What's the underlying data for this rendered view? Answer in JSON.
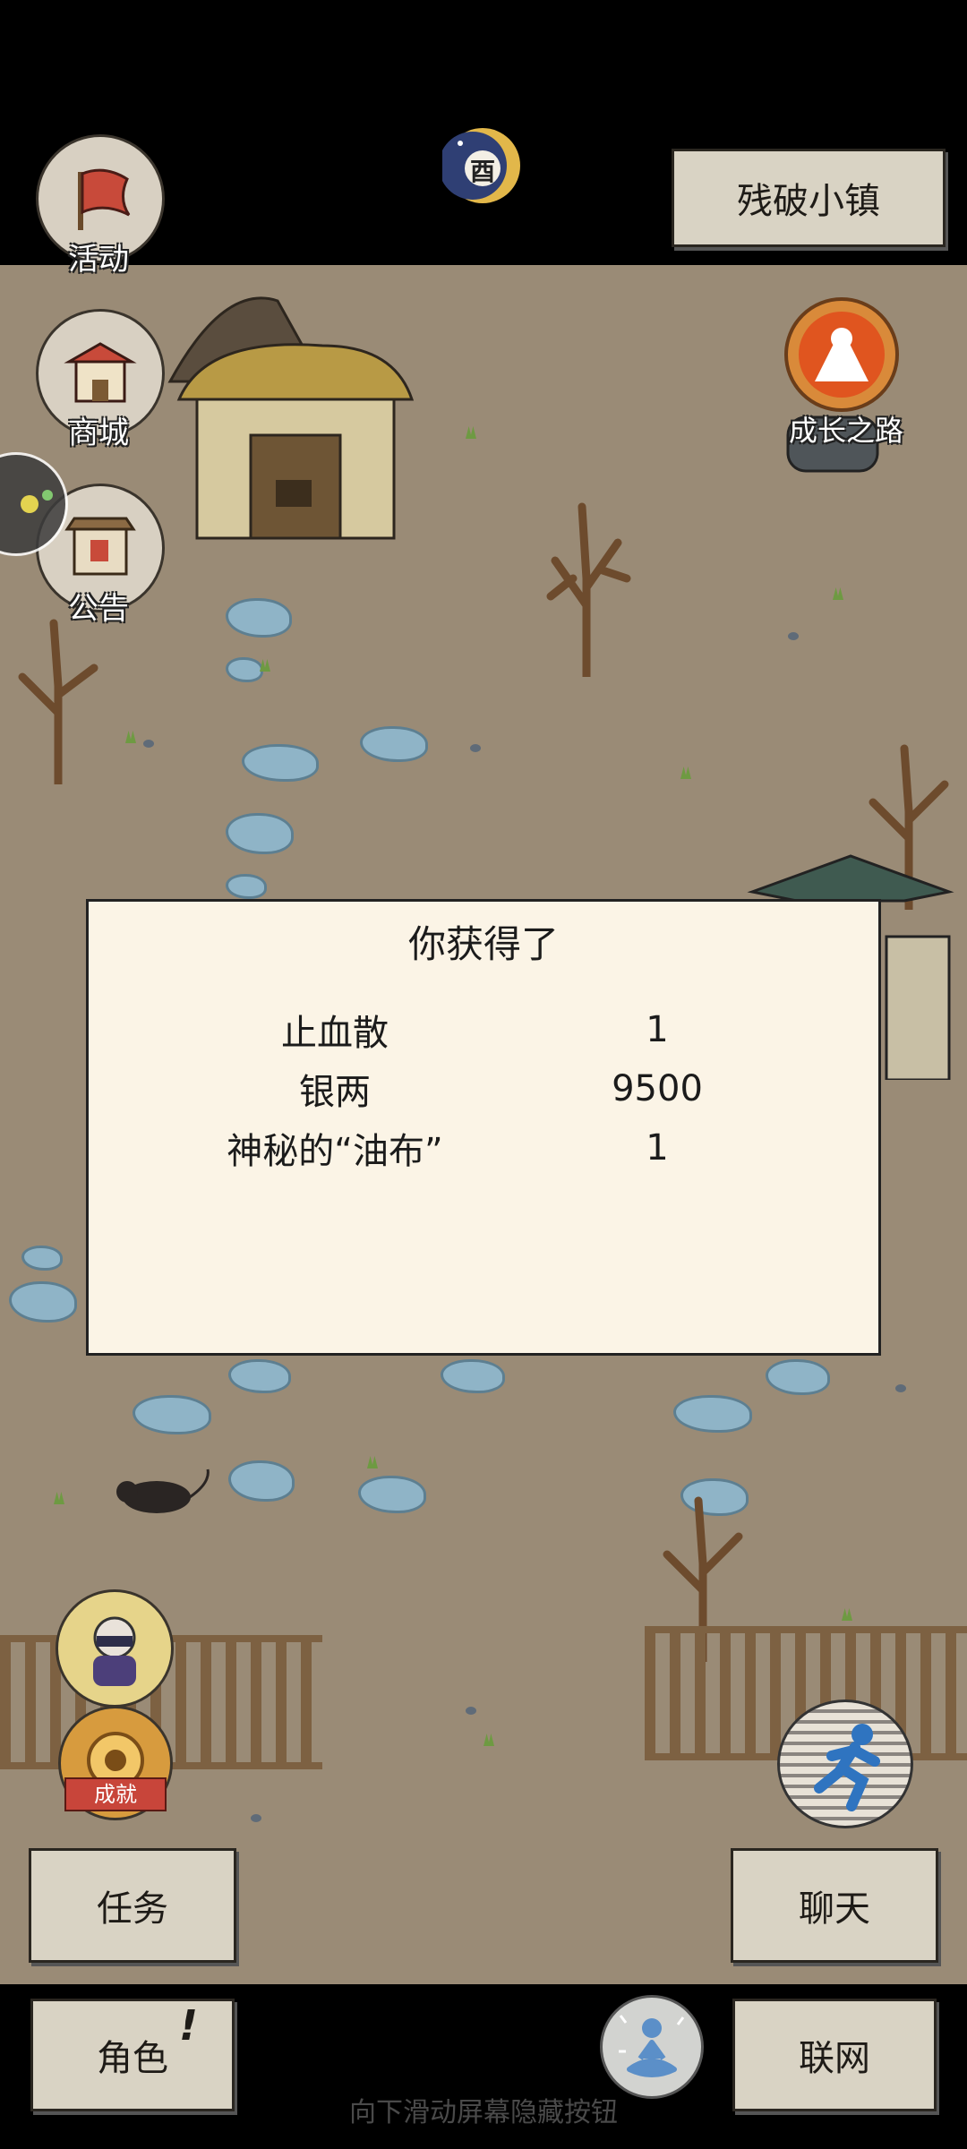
{
  "top": {
    "location_label": "残破小镇",
    "time_badge": "酉"
  },
  "side_menu": {
    "activity": "活动",
    "shop": "商城",
    "notice": "公告",
    "growth_path": "成长之路"
  },
  "modal": {
    "title": "你获得了",
    "rewards": [
      {
        "name": "止血散",
        "qty": "1"
      },
      {
        "name": "银两",
        "qty": "9500"
      },
      {
        "name": "神秘的“油布”",
        "qty": "1"
      }
    ]
  },
  "left_lower": {
    "achievement_ribbon": "成就"
  },
  "buttons": {
    "task": "任务",
    "chat": "聊天",
    "role": "角色",
    "role_alert": "!",
    "network": "联网"
  },
  "hint": "向下滑动屏幕隐藏按钮",
  "colors": {
    "ground": "#9a8b76",
    "stone": "#8fb4c7",
    "modal_bg": "#fbf4e6",
    "button_bg": "#d9d3c4",
    "growth_orange": "#e0551f"
  }
}
